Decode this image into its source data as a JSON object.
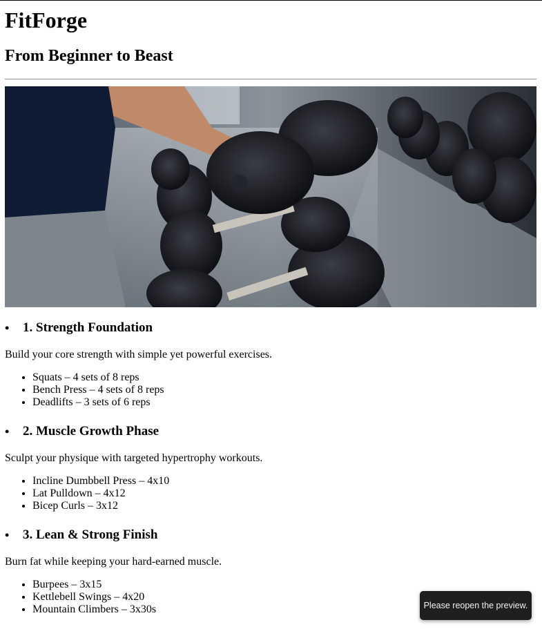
{
  "site": {
    "title": "FitForge",
    "tagline": "From Beginner to Beast"
  },
  "hero": {
    "alt": "Person lifting dumbbells at gym rack",
    "icon": "dumbbell-photo"
  },
  "phases": [
    {
      "title": "1. Strength Foundation",
      "description": "Build your core strength with simple yet powerful exercises.",
      "exercises": [
        "Squats – 4 sets of 8 reps",
        "Bench Press – 4 sets of 8 reps",
        "Deadlifts – 3 sets of 6 reps"
      ]
    },
    {
      "title": "2. Muscle Growth Phase",
      "description": "Sculpt your physique with targeted hypertrophy workouts.",
      "exercises": [
        "Incline Dumbbell Press – 4x10",
        "Lat Pulldown – 4x12",
        "Bicep Curls – 3x12"
      ]
    },
    {
      "title": "3. Lean & Strong Finish",
      "description": "Burn fat while keeping your hard-earned muscle.",
      "exercises": [
        "Burpees – 3x15",
        "Kettlebell Swings – 4x20",
        "Mountain Climbers – 3x30s"
      ]
    }
  ],
  "toast": {
    "message": "Please reopen the preview."
  },
  "colors": {
    "toast_bg": "#1f1f1f",
    "divider": "#9a9a9a"
  }
}
